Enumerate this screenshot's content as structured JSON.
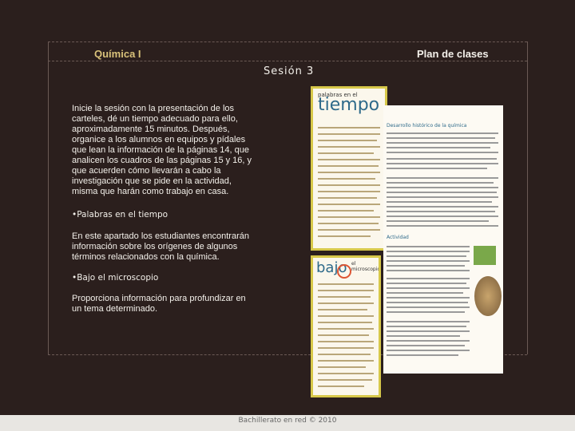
{
  "header": {
    "left_title": "Química I",
    "right_title": "Plan de clases",
    "session": "Sesión 3"
  },
  "content": {
    "paragraph1": "Inicie la sesión con la presentación de los carteles, dé un tiempo adecuado para ello, aproximadamente 15 minutos. Después, organice a los alumnos en equipos y pídales que lean la información de la páginas 14, que analicen los cuadros de las páginas 15 y 16, y que acuerden cómo llevarán a cabo la investigación que se pide en la actividad, misma que harán como trabajo en casa.",
    "bullet1": "•Palabras en el tiempo",
    "paragraph2": "En este apartado los estudiantes encontrarán información sobre los orígenes de algunos términos relacionados con la química.",
    "bullet2": "•Bajo el microscopio",
    "paragraph3": "Proporciona información para profundizar en un tema determinado."
  },
  "images": {
    "page1_small_label": "palabras en el",
    "page1_big_label": "tiempo",
    "page2_bajo": "bajo",
    "page2_label": "el microscopio",
    "spread_title": "Desarrollo histórico de la química",
    "spread_subtitle": "Actividad"
  },
  "footer": {
    "text": "Bachillerato en red © 2010"
  },
  "colors": {
    "background": "#2b1f1d",
    "accent_gold": "#d9c27a",
    "text": "#f3f0ea",
    "frame": "#d7c84a"
  }
}
